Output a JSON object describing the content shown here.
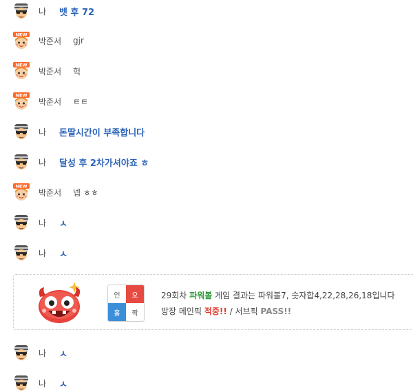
{
  "messages_top": [
    {
      "type": "me",
      "nick": "나",
      "text": "벳 후 72"
    },
    {
      "type": "other",
      "nick": "박준서",
      "text": "gjr"
    },
    {
      "type": "other",
      "nick": "박준서",
      "text": "헉"
    },
    {
      "type": "other",
      "nick": "박준서",
      "text": "ㅌㅌ"
    },
    {
      "type": "me",
      "nick": "나",
      "text": "돈딸시간이 부족합니다"
    },
    {
      "type": "me",
      "nick": "나",
      "text": "달성 후 2차가셔야죠 ㅎ"
    },
    {
      "type": "other",
      "nick": "박준서",
      "text": "넵 ㅎㅎ"
    },
    {
      "type": "me",
      "nick": "나",
      "text": "ㅅ"
    },
    {
      "type": "me",
      "nick": "나",
      "text": "ㅅ"
    }
  ],
  "avatar_badge": "NEW",
  "result": {
    "grid": [
      "언",
      "오",
      "홀",
      "짝"
    ],
    "round": "29회차",
    "game_name": "파워볼",
    "result_text": "게임 결과는 파워볼7, 숫자합4,22,28,26,18입니다",
    "pick_prefix": "방장 메인픽",
    "main_pick": "적중!!",
    "separator": "/ 서브픽",
    "sub_pick": "PASS!!"
  },
  "messages_bottom": [
    {
      "type": "me",
      "nick": "나",
      "text": "ㅅ"
    },
    {
      "type": "me",
      "nick": "나",
      "text": "ㅅ"
    }
  ],
  "colors": {
    "me_text": "#2a62b8",
    "green": "#2e9a3a",
    "red": "#e0392e",
    "blue": "#3b8fd8"
  }
}
